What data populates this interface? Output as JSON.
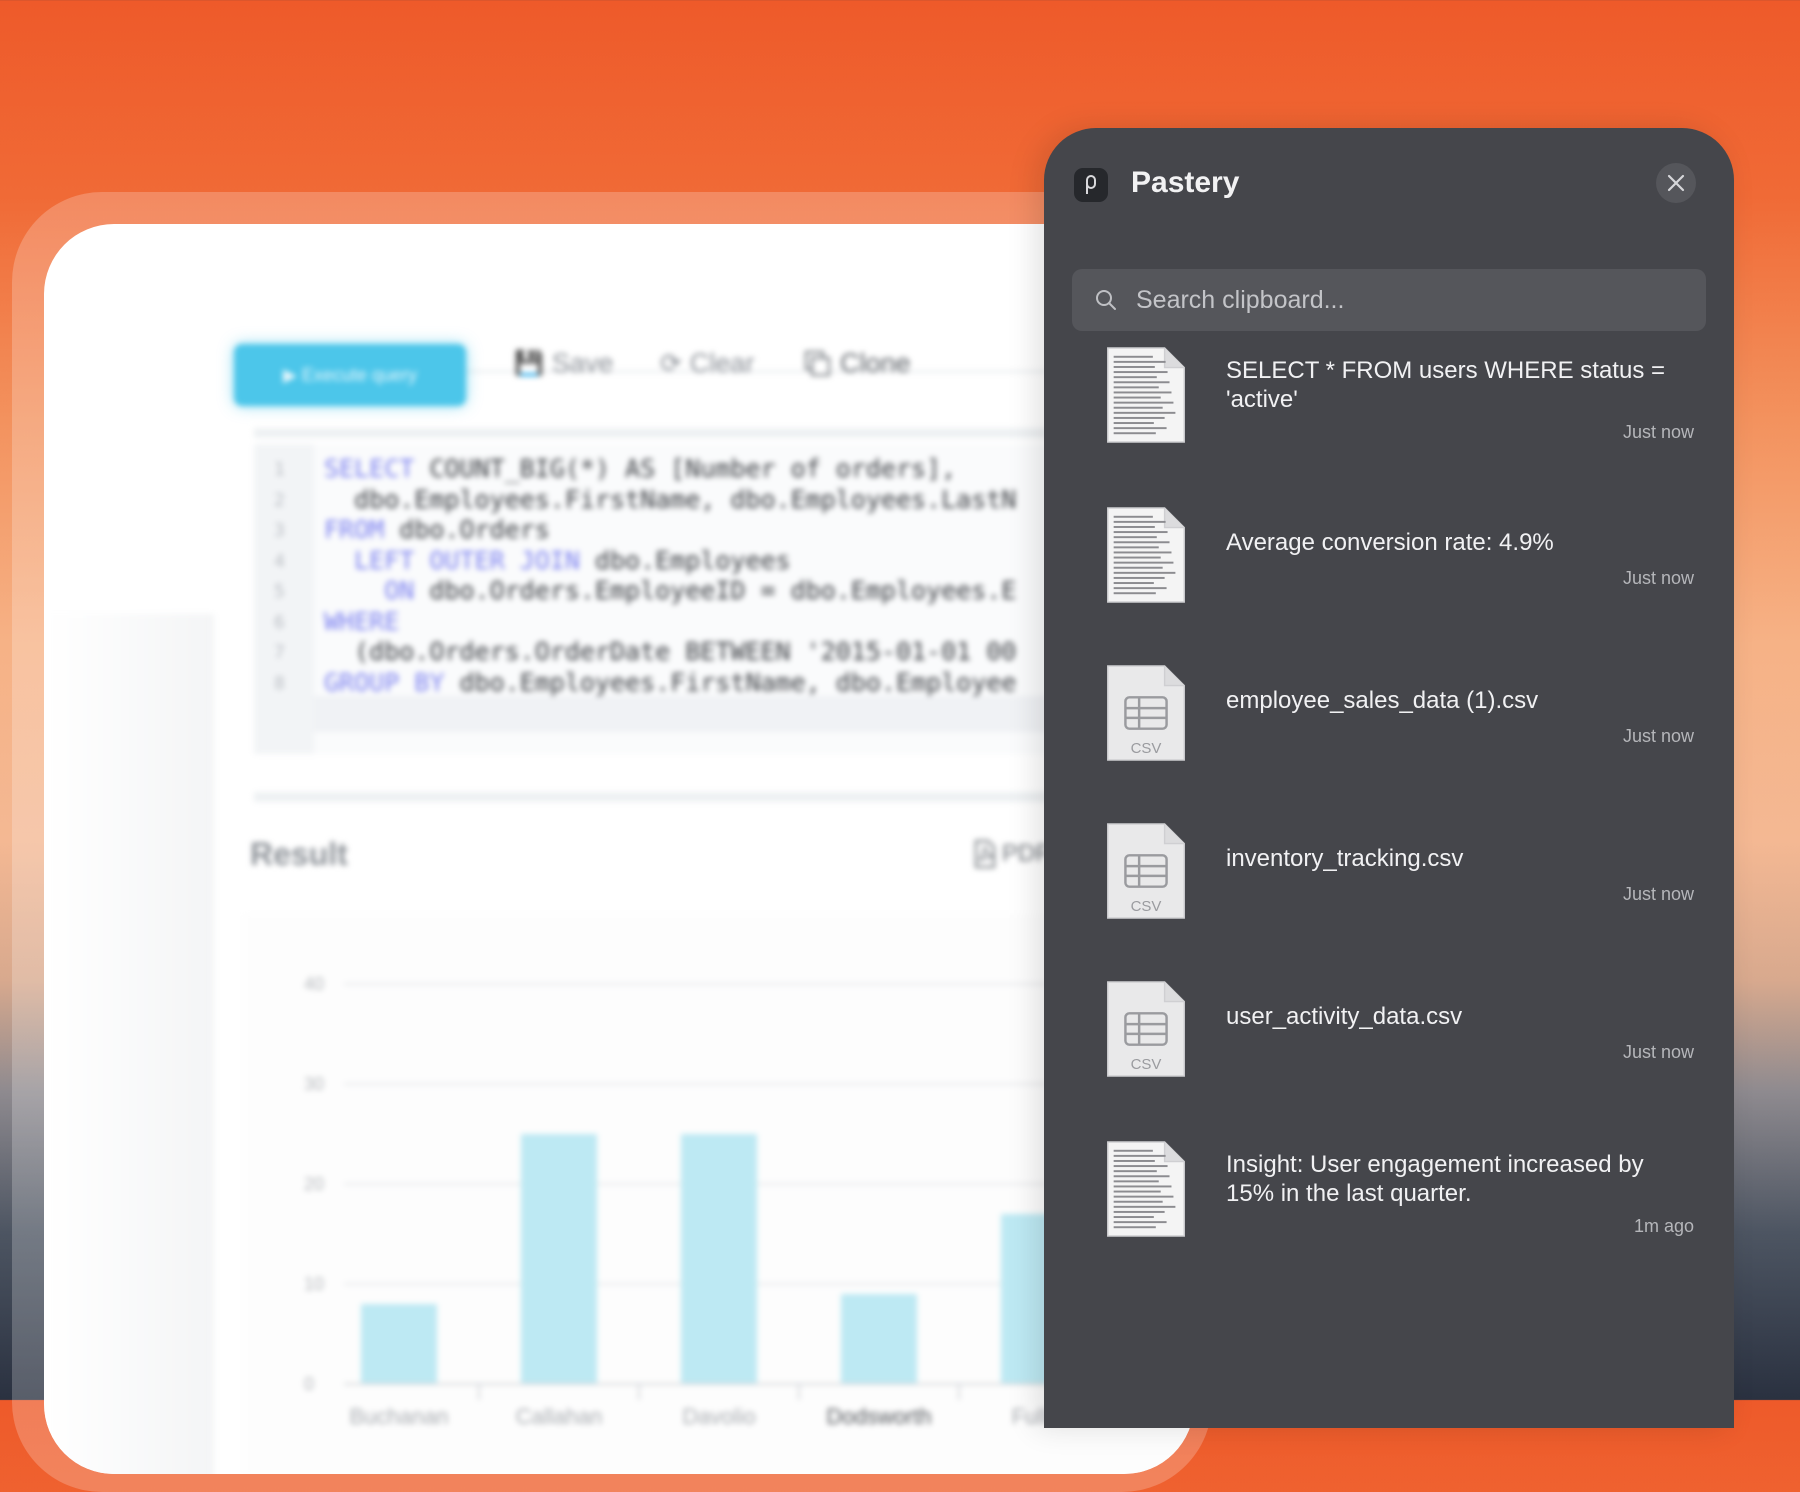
{
  "background_app": {
    "toolbar": {
      "run_label": "Execute query",
      "save_label": "Save",
      "clear_label": "Clear",
      "clone_label": "Clone"
    },
    "editor": {
      "line_numbers": [
        "1",
        "2",
        "3",
        "4",
        "5",
        "6",
        "7",
        "8"
      ],
      "lines": [
        {
          "kw": "SELECT",
          "text": " COUNT_BIG(*) AS [Number of orders],"
        },
        {
          "kw": "",
          "text": "  dbo.Employees.FirstName, dbo.Employees.LastN"
        },
        {
          "kw": "FROM",
          "text": " dbo.Orders"
        },
        {
          "kw": "  LEFT OUTER JOIN",
          "text": " dbo.Employees"
        },
        {
          "kw": "    ON",
          "text": " dbo.Orders.EmployeeID = dbo.Employees.E"
        },
        {
          "kw": "WHERE",
          "text": ""
        },
        {
          "kw": "",
          "text": "  (dbo.Orders.OrderDate BETWEEN '2015-01-01 00"
        },
        {
          "kw": "GROUP BY",
          "text": " dbo.Employees.FirstName, dbo.Employee"
        }
      ]
    },
    "result": {
      "title": "Result",
      "pdf_label": "PDF"
    }
  },
  "chart_data": {
    "type": "bar",
    "categories": [
      "Buchanan",
      "Callahan",
      "Davolio",
      "Dodsworth",
      "Fuller"
    ],
    "values": [
      8,
      25,
      25,
      9,
      17
    ],
    "ylim": [
      0,
      40
    ],
    "yticks": [
      "0",
      "10",
      "20",
      "30",
      "40"
    ],
    "grid": true,
    "bar_color": "#bde9f3"
  },
  "pastery": {
    "title": "Pastery",
    "search": {
      "placeholder": "Search clipboard...",
      "value": ""
    },
    "items": [
      {
        "kind": "text",
        "thumb_icon": "document-thumbnail",
        "text": "SELECT * FROM users WHERE status = 'active'",
        "time": "Just now"
      },
      {
        "kind": "text",
        "thumb_icon": "document-thumbnail",
        "text": "Average conversion rate: 4.9%",
        "time": "Just now"
      },
      {
        "kind": "csv",
        "thumb_icon": "csv-file",
        "thumb_label": "CSV",
        "text": "employee_sales_data (1).csv",
        "time": "Just now"
      },
      {
        "kind": "csv",
        "thumb_icon": "csv-file",
        "thumb_label": "CSV",
        "text": "inventory_tracking.csv",
        "time": "Just now"
      },
      {
        "kind": "csv",
        "thumb_icon": "csv-file",
        "thumb_label": "CSV",
        "text": "user_activity_data.csv",
        "time": "Just now"
      },
      {
        "kind": "text",
        "thumb_icon": "document-thumbnail",
        "text": "Insight: User engagement increased by 15% in the last quarter.",
        "time": "1m ago"
      }
    ],
    "colors": {
      "panel_bg": "#45464b",
      "search_bg": "#55565b",
      "accent_orange": "#f0622f",
      "chart_bar": "#bde9f3",
      "run_button": "#4cc6ea"
    }
  }
}
